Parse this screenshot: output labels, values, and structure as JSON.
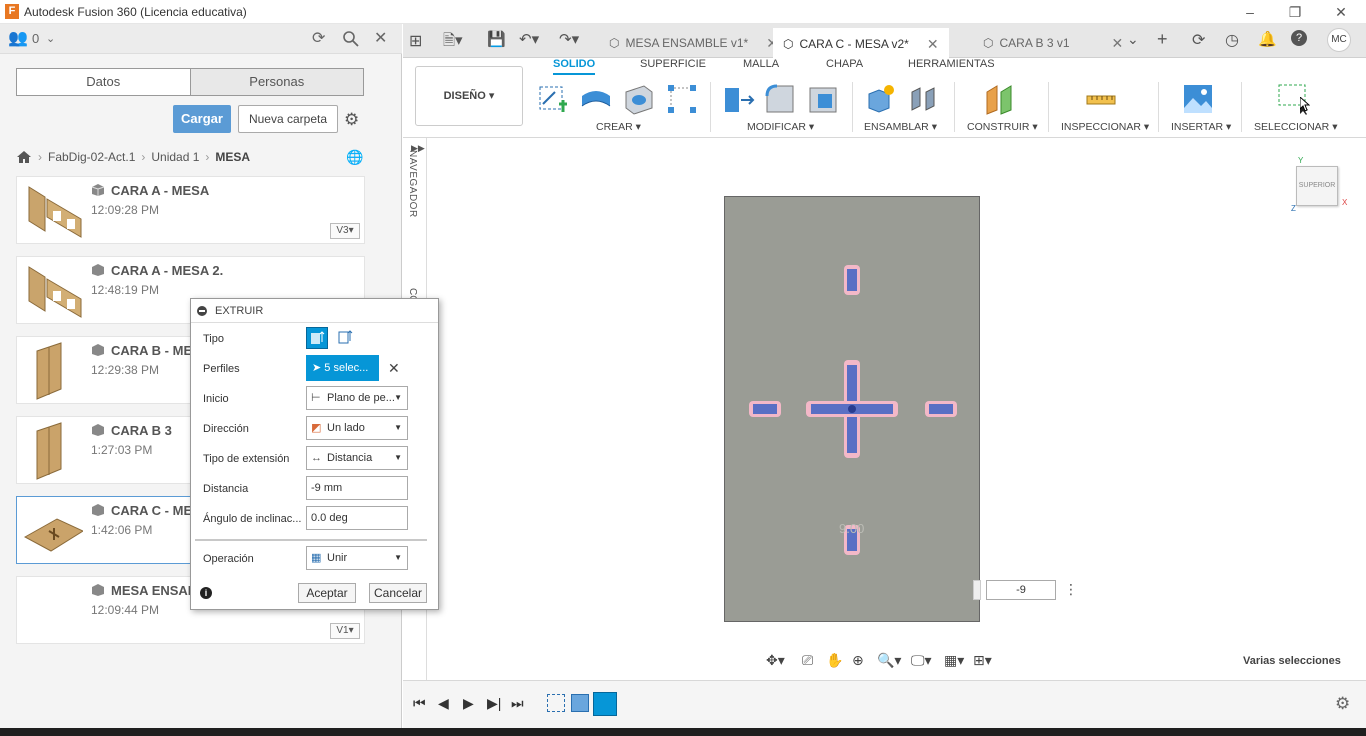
{
  "window": {
    "title": "Autodesk Fusion 360 (Licencia educativa)",
    "logo": "F"
  },
  "left_panel": {
    "team_count": "0",
    "segments": [
      "Datos",
      "Personas"
    ],
    "upload_label": "Cargar",
    "new_folder_label": "Nueva carpeta",
    "breadcrumb": [
      "FabDig-02-Act.1",
      "Unidad 1",
      "MESA"
    ],
    "files": [
      {
        "name": "CARA A - MESA",
        "time": "12:09:28 PM",
        "version": "V3"
      },
      {
        "name": "CARA A - MESA 2.",
        "time": "12:48:19 PM",
        "version": ""
      },
      {
        "name": "CARA B - ME",
        "time": "12:29:38 PM",
        "version": ""
      },
      {
        "name": "CARA B 3",
        "time": "1:27:03 PM",
        "version": ""
      },
      {
        "name": "CARA C - ME",
        "time": "1:42:06 PM",
        "version": ""
      },
      {
        "name": "MESA ENSAI",
        "time": "12:09:44 PM",
        "version": "V1"
      }
    ]
  },
  "tabs": [
    {
      "label": "MESA ENSAMBLE v1*"
    },
    {
      "label": "CARA C - MESA v2*"
    },
    {
      "label": "CARA B 3 v1"
    }
  ],
  "ribbon": {
    "workspace": "DISEÑO",
    "tabs": [
      "SOLIDO",
      "SUPERFICIE",
      "MALLA",
      "CHAPA",
      "HERRAMIENTAS"
    ],
    "groups": [
      "CREAR",
      "MODIFICAR",
      "ENSAMBLAR",
      "CONSTRUIR",
      "INSPECCIONAR",
      "INSERTAR",
      "SELECCIONAR"
    ]
  },
  "browser_label": "NAVEGADOR",
  "browser_label_2": "CO",
  "viewcube": {
    "face": "SUPERIOR",
    "axis_y": "Y",
    "axis_x": "X",
    "axis_z": "Z"
  },
  "canvas": {
    "dimension_text": "9.00",
    "value_input": "-9",
    "status": "Varias selecciones"
  },
  "dialog": {
    "title": "EXTRUIR",
    "rows": {
      "tipo": "Tipo",
      "perfiles": "Perfiles",
      "inicio": "Inicio",
      "direccion": "Dirección",
      "tipo_extension": "Tipo de extensión",
      "distancia": "Distancia",
      "angulo": "Ángulo de inclinac...",
      "operacion": "Operación"
    },
    "values": {
      "perfiles": "5 selec...",
      "inicio": "Plano de pe...",
      "direccion": "Un lado",
      "tipo_extension": "Distancia",
      "distancia": "-9 mm",
      "angulo": "0.0 deg",
      "operacion": "Unir"
    },
    "ok_label": "Aceptar",
    "cancel_label": "Cancelar"
  },
  "colors": {
    "accent": "#0696d7",
    "upload": "#5b9bd5",
    "part": "#9a9c95",
    "profile": "#5a6fc4"
  }
}
